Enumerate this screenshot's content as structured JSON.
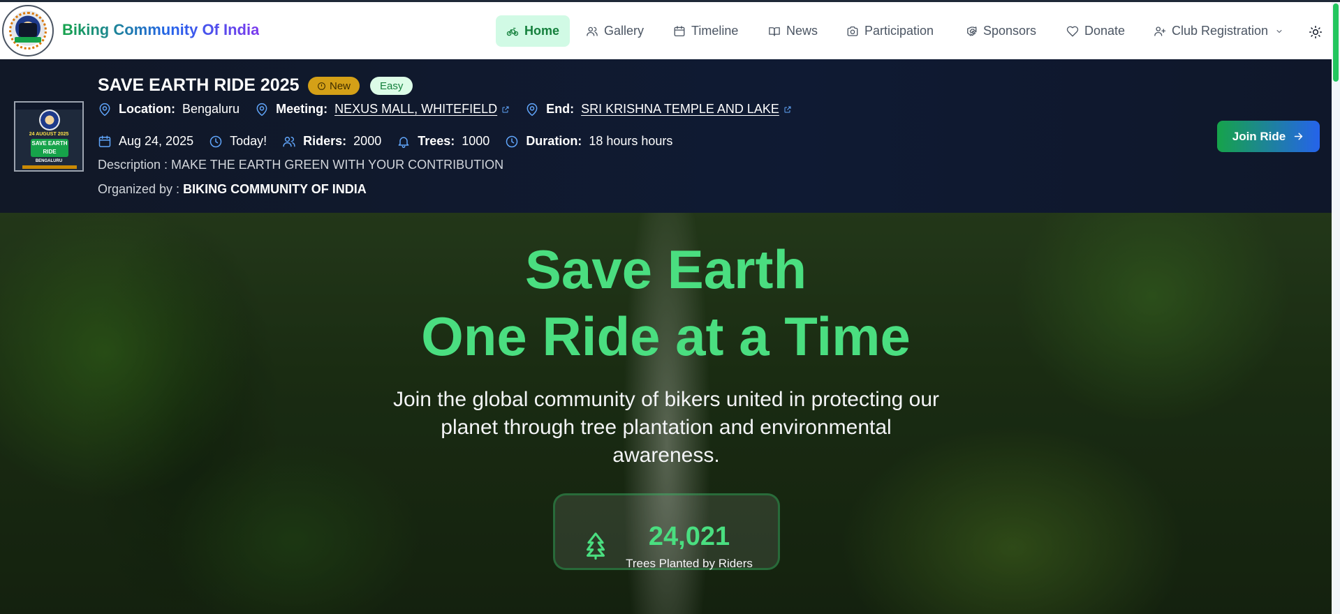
{
  "brand": {
    "name": "Biking Community Of India",
    "logo_icon": "club-logo"
  },
  "nav": {
    "items": [
      {
        "label": "Home",
        "icon": "bicycle-icon",
        "active": true
      },
      {
        "label": "Gallery",
        "icon": "users-icon"
      },
      {
        "label": "Timeline",
        "icon": "calendar-icon"
      },
      {
        "label": "News",
        "icon": "book-open-icon"
      },
      {
        "label": "Participation",
        "icon": "camera-icon"
      },
      {
        "label": "Sponsors",
        "icon": "handshake-icon"
      },
      {
        "label": "Donate",
        "icon": "heart-icon"
      },
      {
        "label": "Club Registration",
        "icon": "user-plus-icon",
        "has_dropdown": true
      }
    ],
    "theme_icon": "sun-icon"
  },
  "event": {
    "title": "SAVE EARTH RIDE 2025",
    "badge_new": "New",
    "badge_difficulty": "Easy",
    "poster": {
      "top_text": "BIKING COMMUNITY OF INDIA",
      "date": "24 AUGUST 2025",
      "title": "SAVE EARTH RIDE",
      "city": "BENGALURU"
    },
    "location_label": "Location:",
    "location": "Bengaluru",
    "meeting_label": "Meeting:",
    "meeting": "NEXUS MALL, WHITEFIELD",
    "end_label": "End:",
    "end": "SRI KRISHNA TEMPLE AND LAKE",
    "date": "Aug 24, 2025",
    "when": "Today!",
    "riders_label": "Riders:",
    "riders": "2000",
    "trees_label": "Trees:",
    "trees": "1000",
    "duration_label": "Duration:",
    "duration": "18 hours hours",
    "description": "Description : MAKE THE EARTH GREEN WITH YOUR CONTRIBUTION",
    "organized_prefix": "Organized by :",
    "organizer": "BIKING COMMUNITY OF INDIA",
    "join_label": "Join Ride"
  },
  "hero": {
    "title_line1": "Save Earth",
    "title_line2": "One Ride at a Time",
    "subtitle": "Join the global community of bikers united in protecting our planet through tree plantation and environmental awareness.",
    "stat_value": "24,021",
    "stat_label": "Trees Planted by Riders",
    "stat_icon": "tree-icon"
  },
  "colors": {
    "accent_green": "#4ade80",
    "active_nav_bg": "#d1fae5",
    "active_nav_text": "#15803d",
    "banner_bg": "#0f172a",
    "badge_new": "#d4a017",
    "join_gradient_start": "#16a34a",
    "join_gradient_end": "#2563eb"
  }
}
